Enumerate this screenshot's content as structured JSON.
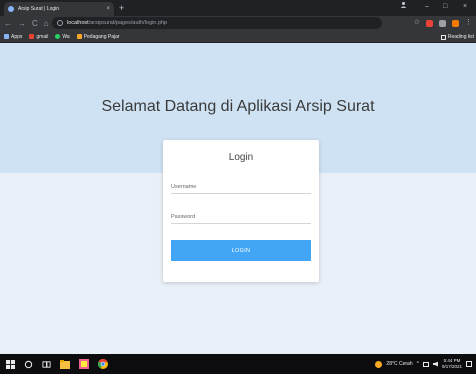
{
  "browser": {
    "tab_title": "Arsip Surat | Login",
    "tab_close": "×",
    "new_tab": "+",
    "minimize": "–",
    "restore": "□",
    "close": "×",
    "back": "←",
    "forward": "→",
    "reload": "C",
    "home": "⌂",
    "url_host": "localhost",
    "url_path": "/arsipsurat/pages/auth/login.php",
    "bookmarks": [
      {
        "label": "Apps",
        "color": "#8ab4f8"
      },
      {
        "label": "gmail",
        "color": "#ea4335"
      },
      {
        "label": "Wa",
        "color": "#25d366"
      },
      {
        "label": "Pedagang Pajar",
        "color": "#f9a825"
      }
    ],
    "reading_list": "Reading list"
  },
  "page": {
    "title": "Selamat Datang di Aplikasi Arsip Surat",
    "login": {
      "title": "Login",
      "username_placeholder": "Username",
      "password_placeholder": "Password",
      "button_label": "LOGIN"
    }
  },
  "taskbar": {
    "weather": "28°C Cerah",
    "clock_time": "5:44 PM",
    "clock_date": "9/17/2021"
  },
  "colors": {
    "hero_bg": "#cfe2f3",
    "page_bg": "#e9f0f8",
    "button": "#42a5f5"
  }
}
